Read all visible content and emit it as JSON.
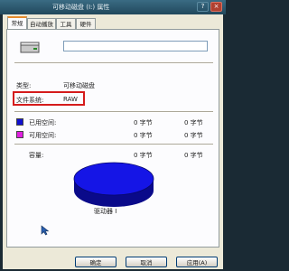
{
  "window": {
    "title": "可移动磁盘 (I:) 属性"
  },
  "tabs": [
    "常规",
    "自动播放",
    "工具",
    "硬件"
  ],
  "general": {
    "name_value": "",
    "type_label": "类型:",
    "type_value": "可移动磁盘",
    "fs_label": "文件系统:",
    "fs_value": "RAW",
    "used_label": "已用空间:",
    "used_value": "0 字节",
    "used_value2": "0 字节",
    "free_label": "可用空间:",
    "free_value": "0 字节",
    "free_value2": "0 字节",
    "capacity_label": "容量:",
    "capacity_value": "0 字节",
    "capacity_value2": "0 字节",
    "drive_caption": "驱动器 I"
  },
  "colors": {
    "used": "#1010d0",
    "free": "#e020e0",
    "highlight": "#d51b1b"
  },
  "buttons": {
    "ok": "确定",
    "cancel": "取消",
    "apply": "应用(A)"
  }
}
